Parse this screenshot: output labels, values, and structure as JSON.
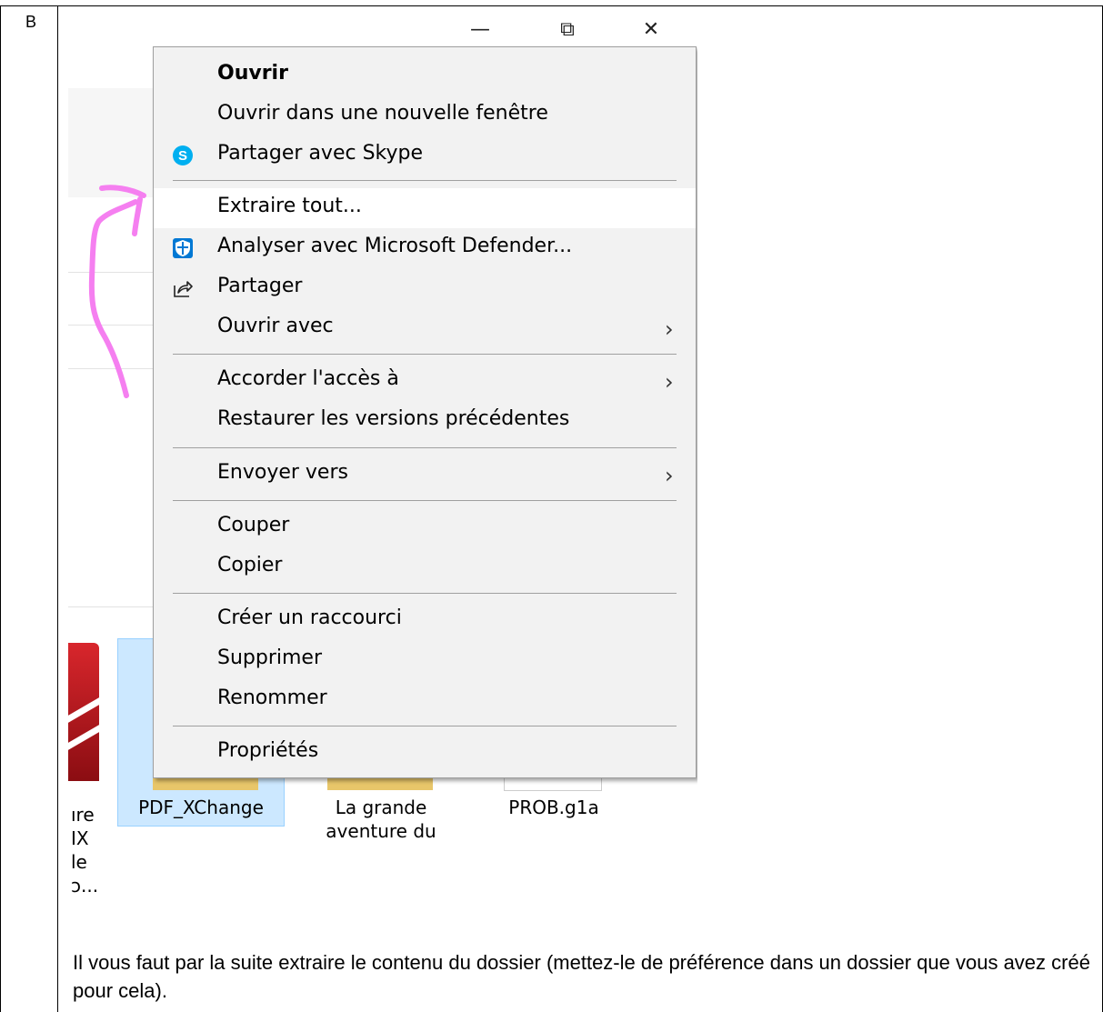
{
  "row_label": "B",
  "window_controls": {
    "minimize": "—",
    "restore": "⧉",
    "close": "✕"
  },
  "context_menu": {
    "items": [
      {
        "label": "Ouvrir"
      },
      {
        "label": "Ouvrir dans une nouvelle fenêtre"
      },
      {
        "label": "Partager avec Skype",
        "icon": "skype-icon"
      },
      {
        "label": "Extraire tout..."
      },
      {
        "label": "Analyser avec Microsoft Defender...",
        "icon": "defender-icon"
      },
      {
        "label": "Partager",
        "icon": "share-icon"
      },
      {
        "label": "Ouvrir avec"
      },
      {
        "label": "Accorder l'accès à"
      },
      {
        "label": "Restaurer les versions précédentes"
      },
      {
        "label": "Envoyer vers"
      },
      {
        "label": "Couper"
      },
      {
        "label": "Copier"
      },
      {
        "label": "Créer un raccourci"
      },
      {
        "label": "Supprimer"
      },
      {
        "label": "Renommer"
      },
      {
        "label": "Propriétés"
      }
    ],
    "submenu_chevron": "›"
  },
  "files": {
    "partial_item_lines": [
      "ıre",
      "IX",
      "le",
      "ɔ..."
    ],
    "items": [
      {
        "name": "PDF_XChange"
      },
      {
        "name_line1": "La grande",
        "name_line2": "aventure du"
      },
      {
        "name": "PROB.g1a"
      }
    ]
  },
  "caption": "Il vous faut par la suite extraire le contenu du dossier (mettez-le de préférence dans un dossier que vous avez créé pour cela).",
  "colors": {
    "annotation_arrow": "#f57ff0",
    "selection": "#cce8ff",
    "menu_bg": "#f2f2f2",
    "skype": "#00aff0",
    "defender": "#0078d4"
  }
}
